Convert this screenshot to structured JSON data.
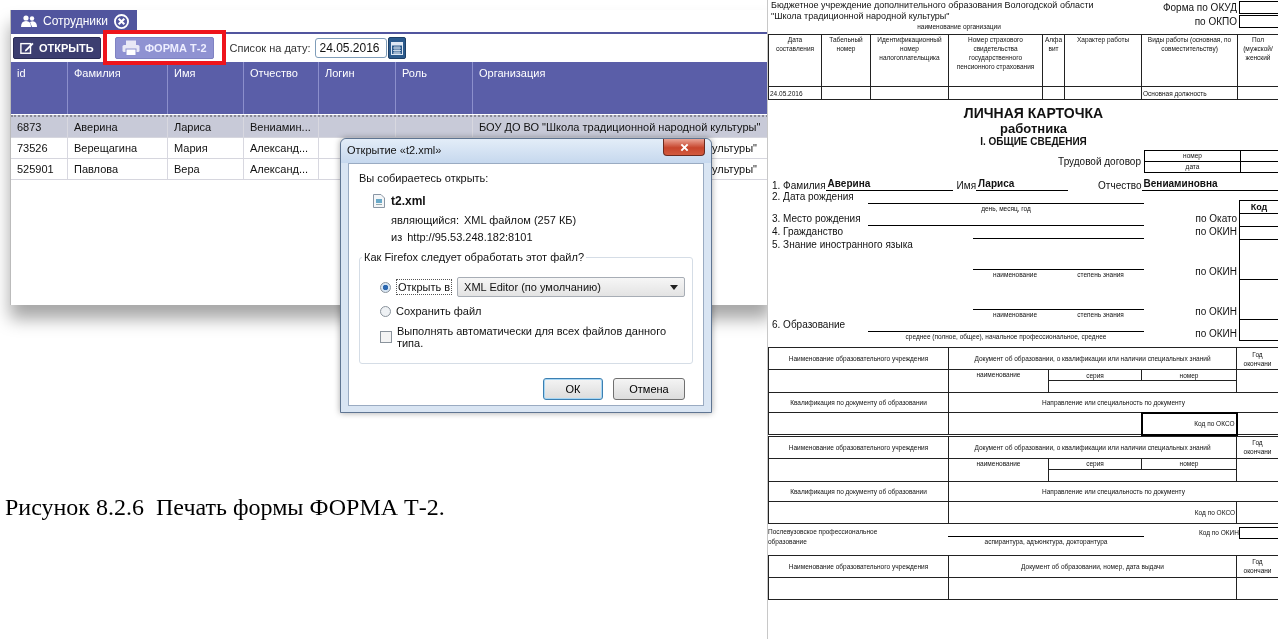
{
  "app": {
    "tab": {
      "label": "Сотрудники"
    },
    "toolbar": {
      "buttons": [
        {
          "label": "ОТКРЫТЬ",
          "kind": "edit",
          "pressed": false,
          "highlighted": false
        },
        {
          "label": "ФОРМА Т-2",
          "kind": "print",
          "pressed": true,
          "highlighted": true
        }
      ],
      "date_label": "Список на дату:",
      "date_value": "24.05.2016"
    },
    "table": {
      "columns": [
        "id",
        "Фамилия",
        "Имя",
        "Отчество",
        "Логин",
        "Роль",
        "Организация"
      ],
      "rows": [
        {
          "id": "6873",
          "surname": "Аверина",
          "name": "Лариса",
          "patronymic": "Вениамин...",
          "organization": "БОУ ДО ВО \"Школа традиционной народной культуры\"",
          "selected": true,
          "partly_hidden": false
        },
        {
          "id": "73526",
          "surname": "Верещагина",
          "name": "Мария",
          "patronymic": "Александ...",
          "organization": "ультуры\"",
          "selected": false,
          "partly_hidden": true
        },
        {
          "id": "525901",
          "surname": "Павлова",
          "name": "Вера",
          "patronymic": "Александ...",
          "organization": "ультуры\"",
          "selected": false,
          "partly_hidden": true
        }
      ]
    }
  },
  "dialog": {
    "title": "Открытие «t2.xml»",
    "prompt": "Вы собираетесь открыть:",
    "file_name": "t2.xml",
    "details": [
      {
        "label": "являющийся:",
        "value": "XML файлом (257 КБ)"
      },
      {
        "label": "из",
        "value": "http://95.53.248.182:8101"
      }
    ],
    "group_title": "Как Firefox следует обработать этот файл?",
    "options": [
      {
        "label": "Открыть в",
        "selected": true,
        "app": "XML Editor (по умолчанию)"
      },
      {
        "label": "Сохранить файл",
        "selected": false
      }
    ],
    "auto_run": {
      "label": "Выполнять автоматически для всех файлов данного типа.",
      "checked": false
    },
    "buttons": [
      {
        "label": "ОК",
        "default": true
      },
      {
        "label": "Отмена",
        "default": false
      }
    ]
  },
  "caption": "Рисунок 8.2.6  Печать формы ФОРМА Т-2.",
  "form": {
    "org_lines": [
      "Бюджетное учреждение дополнительного образования Вологодской области",
      "\"Школа традиционной народной культуры\""
    ],
    "org_caption": "наименование организации",
    "org_codes": [
      "Форма по ОКУД",
      "по ОКПО"
    ],
    "header_cells": [
      {
        "heading": "Дата составления",
        "value": "24.05.2016"
      },
      {
        "heading": "Табельный номер"
      },
      {
        "heading": "Идентификационный номер налогоплательщика"
      },
      {
        "heading": "Номер страхового свидетельства государственного пенсионного страхования"
      },
      {
        "heading": "Алфавит"
      },
      {
        "heading": "Характер работы"
      },
      {
        "heading": "Виды работы (основная, по совместительству)",
        "value": "Основная должность"
      },
      {
        "heading": "Пол (мужской/ женский"
      }
    ],
    "title": "ЛИЧНАЯ КАРТОЧКА",
    "subtitle": "работника",
    "section": "I. ОБЩИЕ СВЕДЕНИЯ",
    "contract": {
      "label": "Трудовой договор",
      "rows": [
        "номер",
        "дата"
      ]
    },
    "person": [
      {
        "label": "1. Фамилия",
        "value": "Аверина"
      },
      {
        "label": "Имя",
        "value": "Лариса"
      },
      {
        "label": "Отчество",
        "value": "Вениаминовна"
      }
    ],
    "items": [
      {
        "kind": "long",
        "label": "2. Дата рождения",
        "hints": [
          "день, месяц, год"
        ],
        "code_heading": "Код"
      },
      {
        "kind": "long",
        "label": "3. Место рождения",
        "code_label": "по Окато"
      },
      {
        "kind": "short",
        "label": "4. Гражданство",
        "code_label": "по ОКИН"
      },
      {
        "kind": "tall",
        "label": "5. Знание иностранного языка",
        "hints": [
          "наименование",
          "степень знания"
        ],
        "code_label": "по ОКИН"
      },
      {
        "kind": "tall",
        "hints": [
          "наименование",
          "степень знания"
        ],
        "code_label": "по ОКИН"
      },
      {
        "kind": "long",
        "label": "6. Образование",
        "hints": [
          "среднее (полное, общее), начальное профессиональное, среднее"
        ],
        "code_label": "по ОКИН"
      }
    ],
    "education": [
      {
        "institution_heading": "Наименование образовательного учреждения",
        "document_heading": "Документ об образовании, о квалификации или наличии специальных знаний",
        "year_heading": "Год окончани",
        "document_columns": [
          "наименование",
          "серия",
          "номер"
        ],
        "qualification_heading": "Квалификация по документу об образовании",
        "specialty_heading": "Направление или специальность по документу",
        "code_label": "Код по ОКСО",
        "code_selected": true
      },
      {
        "institution_heading": "Наименование образовательного учреждения",
        "document_heading": "Документ об образовании, о квалификации или наличии специальных знаний",
        "year_heading": "Год окончани",
        "document_columns": [
          "наименование",
          "серия",
          "номер"
        ],
        "qualification_heading": "Квалификация по документу об образовании",
        "specialty_heading": "Направление или специальность по документу",
        "code_label": "Код по ОКСО",
        "code_selected": false
      }
    ],
    "postgraduate": {
      "label": "Послевузовское профессиональное образование",
      "hint": "аспирантура, адъюнктура, докторантура",
      "code_label": "Код по ОКИН"
    },
    "last_table": {
      "headings": [
        "Наименование образовательного учреждения",
        "Документ об образовании, номер, дата выдачи",
        "Год окончани"
      ]
    }
  }
}
